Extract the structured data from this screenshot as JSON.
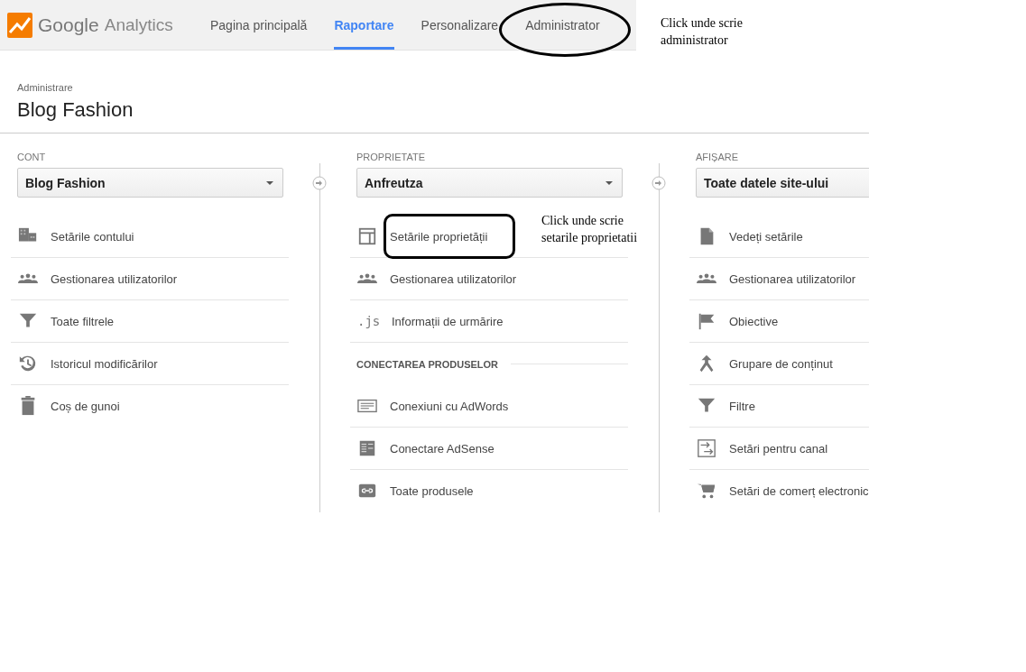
{
  "header": {
    "brand": "Google",
    "product": "Analytics",
    "nav": [
      {
        "label": "Pagina principală",
        "selected": false
      },
      {
        "label": "Raportare",
        "selected": true
      },
      {
        "label": "Personalizare",
        "selected": false
      },
      {
        "label": "Administrator",
        "selected": false
      }
    ]
  },
  "annotations": {
    "nav_note": "Click unde scrie administrator",
    "item_note": "Click unde scrie setarile proprietatii"
  },
  "breadcrumb": "Administrare",
  "title": "Blog Fashion",
  "columns": [
    {
      "heading": "CONT",
      "selector": "Blog Fashion",
      "items": [
        {
          "kind": "link",
          "label": "Setările contului"
        },
        {
          "kind": "link",
          "label": "Gestionarea utilizatorilor"
        },
        {
          "kind": "link",
          "label": "Toate filtrele"
        },
        {
          "kind": "link",
          "label": "Istoricul modificărilor"
        },
        {
          "kind": "link",
          "label": "Coș de gunoi"
        }
      ]
    },
    {
      "heading": "PROPRIETATE",
      "selector": "Anfreutza",
      "items": [
        {
          "kind": "link",
          "label": "Setările proprietății",
          "circled": true
        },
        {
          "kind": "link",
          "label": "Gestionarea utilizatorilor"
        },
        {
          "kind": "link",
          "icon_text": ".js",
          "label": "Informații de urmărire"
        },
        {
          "kind": "section",
          "label": "CONECTAREA PRODUSELOR"
        },
        {
          "kind": "link",
          "label": "Conexiuni cu AdWords"
        },
        {
          "kind": "link",
          "label": "Conectare AdSense"
        },
        {
          "kind": "link",
          "label": "Toate produsele"
        }
      ]
    },
    {
      "heading": "AFIȘARE",
      "selector": "Toate datele site-ului",
      "items": [
        {
          "kind": "link",
          "label": "Vedeți setările"
        },
        {
          "kind": "link",
          "label": "Gestionarea utilizatorilor"
        },
        {
          "kind": "link",
          "label": "Obiective"
        },
        {
          "kind": "link",
          "label": "Grupare de conținut"
        },
        {
          "kind": "link",
          "label": "Filtre"
        },
        {
          "kind": "link",
          "label": "Setări pentru canal"
        },
        {
          "kind": "link",
          "label": "Setări de comerț electronic"
        }
      ]
    }
  ]
}
